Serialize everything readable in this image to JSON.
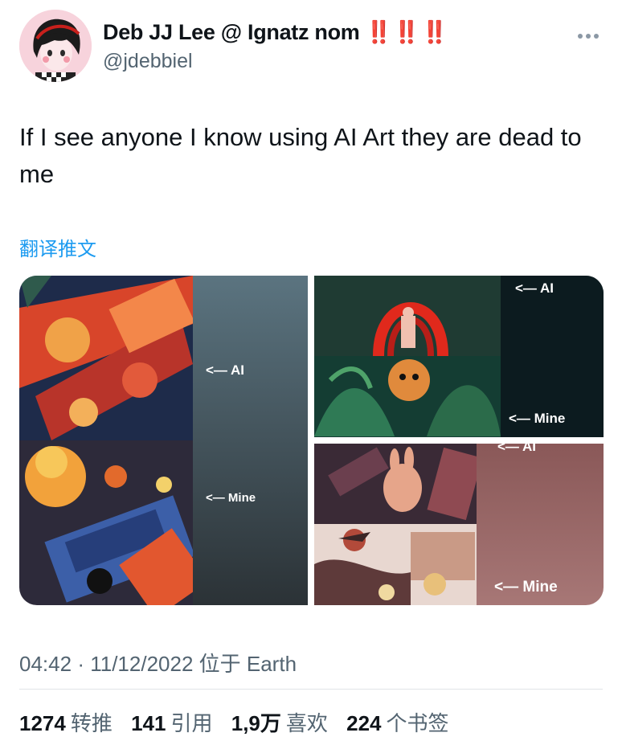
{
  "author": {
    "display_name": "Deb JJ Lee @ Ignatz nom",
    "emoji": "‼️‼️‼️",
    "handle": "@jdebbiel"
  },
  "tweet": {
    "text": "If I see anyone I know using AI Art they are dead to me",
    "translate_label": "翻译推文"
  },
  "media": {
    "image1": {
      "label_top": "<— AI",
      "label_bottom": "<— Mine"
    },
    "image2": {
      "label_top": "<— AI",
      "label_bottom": "<— Mine"
    },
    "image3": {
      "label_top": "<— AI",
      "label_bottom": "<— Mine"
    }
  },
  "meta": {
    "time": "04:42",
    "separator": "·",
    "date": "11/12/2022",
    "location": "位于 Earth"
  },
  "stats": [
    {
      "count": "1274",
      "label": "转推"
    },
    {
      "count": "141",
      "label": "引用"
    },
    {
      "count": "1,9万",
      "label": "喜欢"
    },
    {
      "count": "224",
      "label": "个书签"
    }
  ],
  "colors": {
    "link": "#1d9bf0",
    "secondary_text": "#536471",
    "emoji_red": "#e0241c"
  },
  "icons": {
    "more": "more-horizontal-icon",
    "avatar": "avatar-illustration"
  }
}
